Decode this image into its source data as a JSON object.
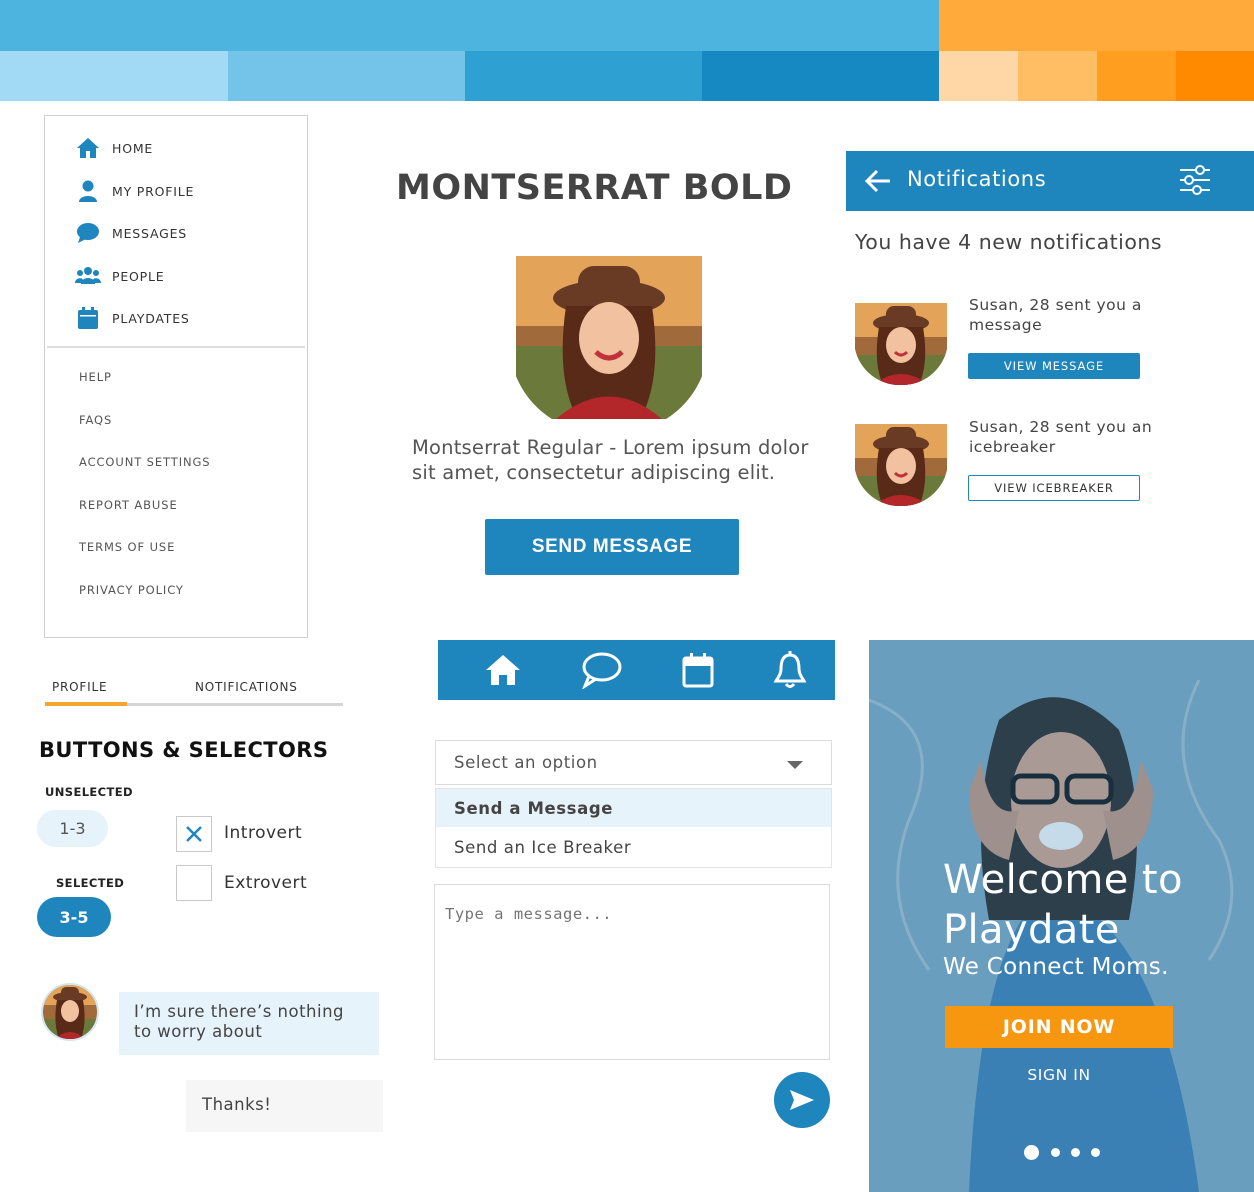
{
  "palette": {
    "top_blue": "#4db3df",
    "top_orange": "#ffaa3a",
    "blues": [
      "#a2d9f5",
      "#74c4ea",
      "#2fa0d2",
      "#1688c2"
    ],
    "oranges": [
      "#ffd6a6",
      "#ffbe63",
      "#ff9e1f",
      "#ff8a00"
    ]
  },
  "sidebar": {
    "items": [
      {
        "label": "HOME",
        "icon": "home-icon"
      },
      {
        "label": "MY PROFILE",
        "icon": "user-icon"
      },
      {
        "label": "MESSAGES",
        "icon": "chat-bubble-icon"
      },
      {
        "label": "PEOPLE",
        "icon": "people-icon"
      },
      {
        "label": "PLAYDATES",
        "icon": "calendar-icon"
      }
    ],
    "links": [
      "HELP",
      "FAQS",
      "ACCOUNT SETTINGS",
      "REPORT ABUSE",
      "TERMS OF USE",
      "PRIVACY POLICY"
    ]
  },
  "profile": {
    "heading": "MONTSERRAT BOLD",
    "body": "Montserrat Regular - Lorem ipsum dolor sit amet, consectetur adipiscing elit.",
    "send_button": "SEND MESSAGE"
  },
  "notifications": {
    "title": "Notifications",
    "summary": "You have 4 new notifications",
    "items": [
      {
        "text": "Susan, 28 sent you a message",
        "button": "VIEW MESSAGE"
      },
      {
        "text": "Susan, 28 sent you an icebreaker",
        "button": "VIEW ICEBREAKER"
      }
    ]
  },
  "tabs": {
    "profile": "PROFILE",
    "notifications": "NOTIFICATIONS"
  },
  "selectors": {
    "title": "BUTTONS & SELECTORS",
    "unselected_label": "UNSELECTED",
    "unselected_value": "1-3",
    "selected_label": "SELECTED",
    "selected_value": "3-5",
    "checkbox1": "Introvert",
    "checkbox2": "Extrovert"
  },
  "chat": {
    "incoming": "I’m sure there’s nothing to worry about",
    "outgoing": "Thanks!"
  },
  "dropdown": {
    "placeholder": "Select an option",
    "options": [
      "Send a Message",
      "Send an Ice Breaker"
    ]
  },
  "message_area": {
    "placeholder": "Type a message..."
  },
  "welcome": {
    "title_line1": "Welcome to",
    "title_line2": "Playdate",
    "subtitle": "We Connect Moms.",
    "join": "JOIN NOW",
    "signin": "SIGN IN"
  }
}
